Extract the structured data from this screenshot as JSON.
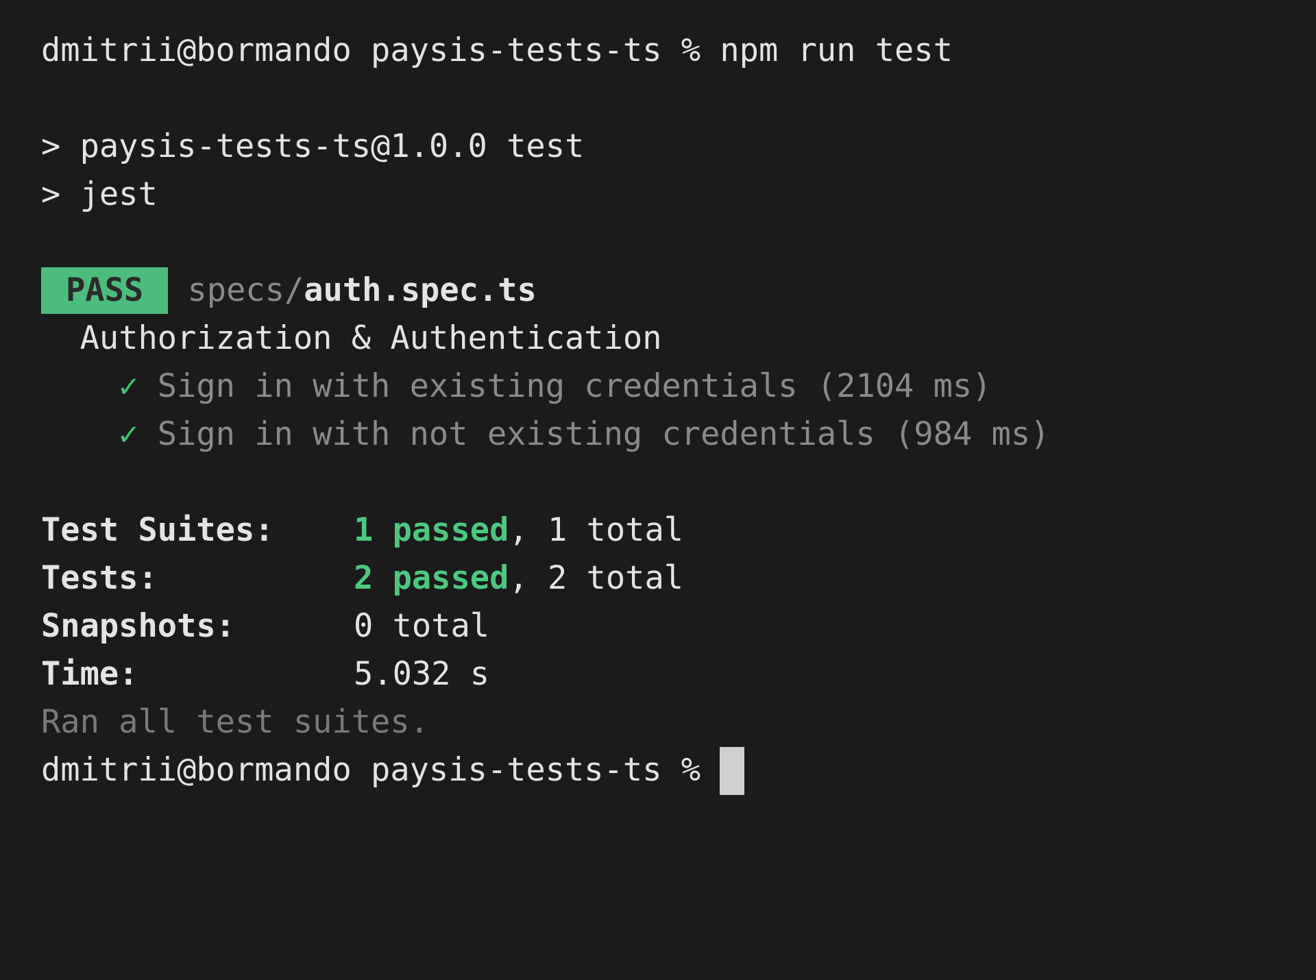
{
  "terminal": {
    "prompt": {
      "user_host": "dmitrii@bormando",
      "cwd": "paysis-tests-ts",
      "symbol": "%",
      "command": "npm run test"
    },
    "script_header": [
      "> paysis-tests-ts@1.0.0 test",
      "> jest"
    ],
    "result": {
      "status_badge": "PASS",
      "file_dir": "specs/",
      "file_name": "auth.spec.ts",
      "describe": "Authorization & Authentication",
      "tests": [
        {
          "check": "✓",
          "name": "Sign in with existing credentials",
          "duration": "(2104 ms)"
        },
        {
          "check": "✓",
          "name": "Sign in with not existing credentials",
          "duration": "(984 ms)"
        }
      ]
    },
    "summary": [
      {
        "label": "Test Suites:",
        "passed": "1 passed",
        "rest": ", 1 total"
      },
      {
        "label": "Tests:",
        "passed": "2 passed",
        "rest": ", 2 total"
      },
      {
        "label": "Snapshots:",
        "passed": "",
        "rest": "0 total"
      },
      {
        "label": "Time:",
        "passed": "",
        "rest": "5.032 s"
      }
    ],
    "footer": "Ran all test suites.",
    "colors": {
      "background": "#1b1b1b",
      "pass_badge": "#4cbd7d",
      "passed_text": "#4cc97f",
      "dim_text": "#8a8a8a"
    }
  }
}
